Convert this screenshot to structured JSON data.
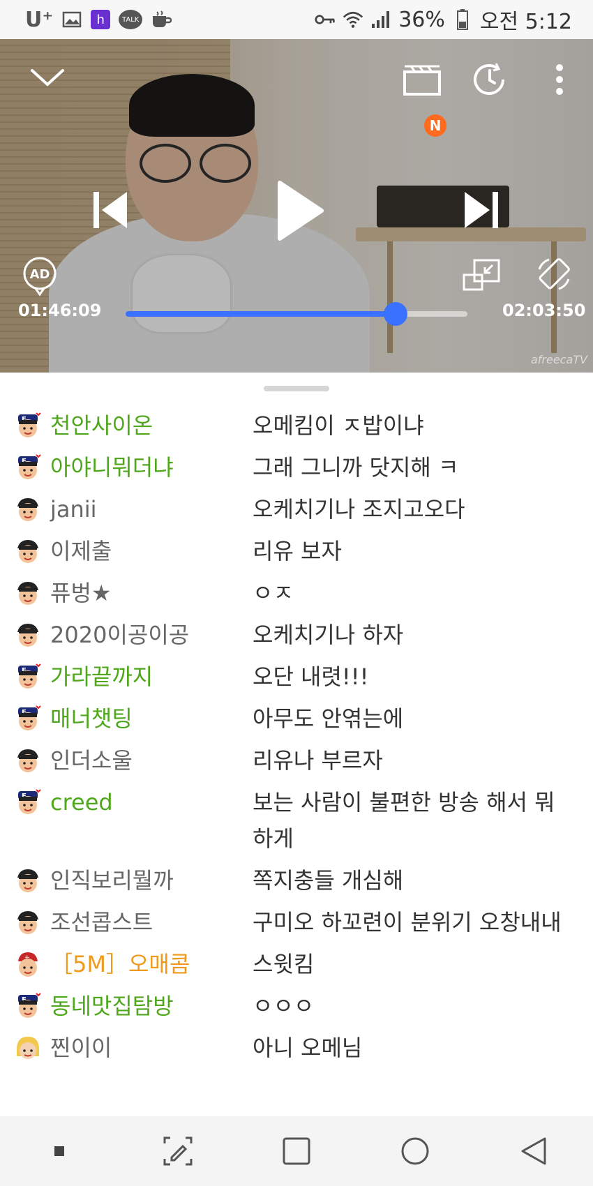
{
  "status_bar": {
    "carrier": "U⁺",
    "battery": "36%",
    "time": "오전 5:12",
    "notification_icons": [
      "image-icon",
      "h-app-icon",
      "talk-icon",
      "coffee-icon"
    ],
    "system_icons": [
      "key-icon",
      "wifi-icon",
      "signal-icon",
      "battery-icon"
    ]
  },
  "player": {
    "current_time": "01:46:09",
    "total_time": "02:03:50",
    "progress_fraction": 0.79,
    "state": "paused",
    "new_badge": "N",
    "ad_label": "AD",
    "watermark": "afreecaTV",
    "accent_color": "#3a72ff"
  },
  "chat": {
    "messages": [
      {
        "nick": "천안사이온",
        "text": "오메킴이 ㅈ밥이냐",
        "role": "fan"
      },
      {
        "nick": "아야니뭐더냐",
        "text": "그래 그니까 닷지해 ㅋ",
        "role": "fan"
      },
      {
        "nick": "janii",
        "text": "오케치기나 조지고오다",
        "role": "normal"
      },
      {
        "nick": "이제출",
        "text": "리유 보자",
        "role": "normal"
      },
      {
        "nick": "퓨벙★",
        "text": "ㅇㅈ",
        "role": "normal"
      },
      {
        "nick": "2020이공이공",
        "text": "오케치기나 하자",
        "role": "normal"
      },
      {
        "nick": "가라끝까지",
        "text": "오단 내렷!!!",
        "role": "fan"
      },
      {
        "nick": "매너챗팅",
        "text": "아무도 안엮는에",
        "role": "fan"
      },
      {
        "nick": "인더소울",
        "text": "리유나 부르자",
        "role": "normal"
      },
      {
        "nick": "creed",
        "text": "보는 사람이 불편한 방송 해서 뭐하게",
        "role": "fan"
      },
      {
        "nick": "인직보리뭘까",
        "text": "쪽지충들 개심해",
        "role": "normal"
      },
      {
        "nick": "조선콥스트",
        "text": "구미오 하꼬련이 분위기 오창내내",
        "role": "normal"
      },
      {
        "nick": "［5M］오매콤",
        "text": "스윗킴",
        "role": "vip"
      },
      {
        "nick": "동네맛집탐방",
        "text": "ㅇㅇㅇ",
        "role": "fan"
      },
      {
        "nick": "찐이이",
        "text": "아니 오메님",
        "role": "normal"
      }
    ]
  },
  "colors": {
    "fan_nick": "#4fa71c",
    "normal_nick": "#666666",
    "vip_nick": "#ef9a1a"
  }
}
